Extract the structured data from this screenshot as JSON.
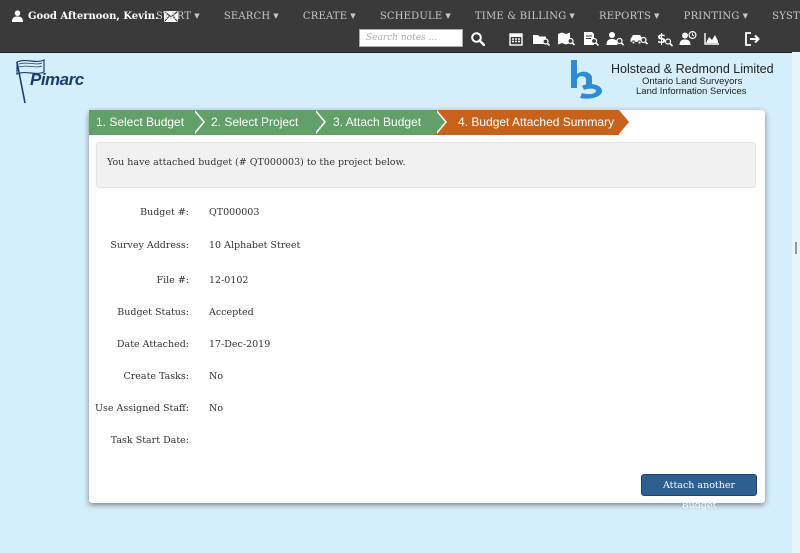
{
  "header": {
    "greeting": "Good Afternoon, Kevin.",
    "nav": [
      {
        "label": "START"
      },
      {
        "label": "SEARCH"
      },
      {
        "label": "CREATE"
      },
      {
        "label": "SCHEDULE"
      },
      {
        "label": "TIME & BILLING"
      },
      {
        "label": "REPORTS"
      },
      {
        "label": "PRINTING"
      },
      {
        "label": "SYSTEM"
      }
    ],
    "search": {
      "placeholder": "Search notes ...",
      "value": ""
    }
  },
  "branding": {
    "app_logo_text": "Pimarc",
    "company_name": "Holstead & Redmond Limited",
    "company_line1": "Ontario Land Surveyors",
    "company_line2": "Land Information Services",
    "accent": "#c6621c",
    "done_color": "#62a069",
    "button_color": "#2d5f93"
  },
  "wizard": {
    "steps": [
      {
        "label": "1. Select Budget",
        "state": "done"
      },
      {
        "label": "2. Select Project",
        "state": "done"
      },
      {
        "label": "3. Attach Budget",
        "state": "done"
      },
      {
        "label": "4. Budget Attached Summary",
        "state": "active"
      }
    ]
  },
  "summary": {
    "notice": "You have attached budget (# QT000003) to the project below.",
    "fields": [
      {
        "label": "Budget #:",
        "value": "QT000003"
      },
      {
        "label": "Survey Address:",
        "value": "10 Alphabet Street"
      },
      {
        "label": "File #:",
        "value": "12-0102"
      },
      {
        "label": "Budget Status:",
        "value": "Accepted"
      },
      {
        "label": "Date Attached:",
        "value": "17-Dec-2019"
      },
      {
        "label": "Create Tasks:",
        "value": "No"
      },
      {
        "label": "Use Assigned Staff:",
        "value": "No"
      },
      {
        "label": "Task Start Date:",
        "value": ""
      }
    ],
    "button_label": "Attach another Budget"
  }
}
